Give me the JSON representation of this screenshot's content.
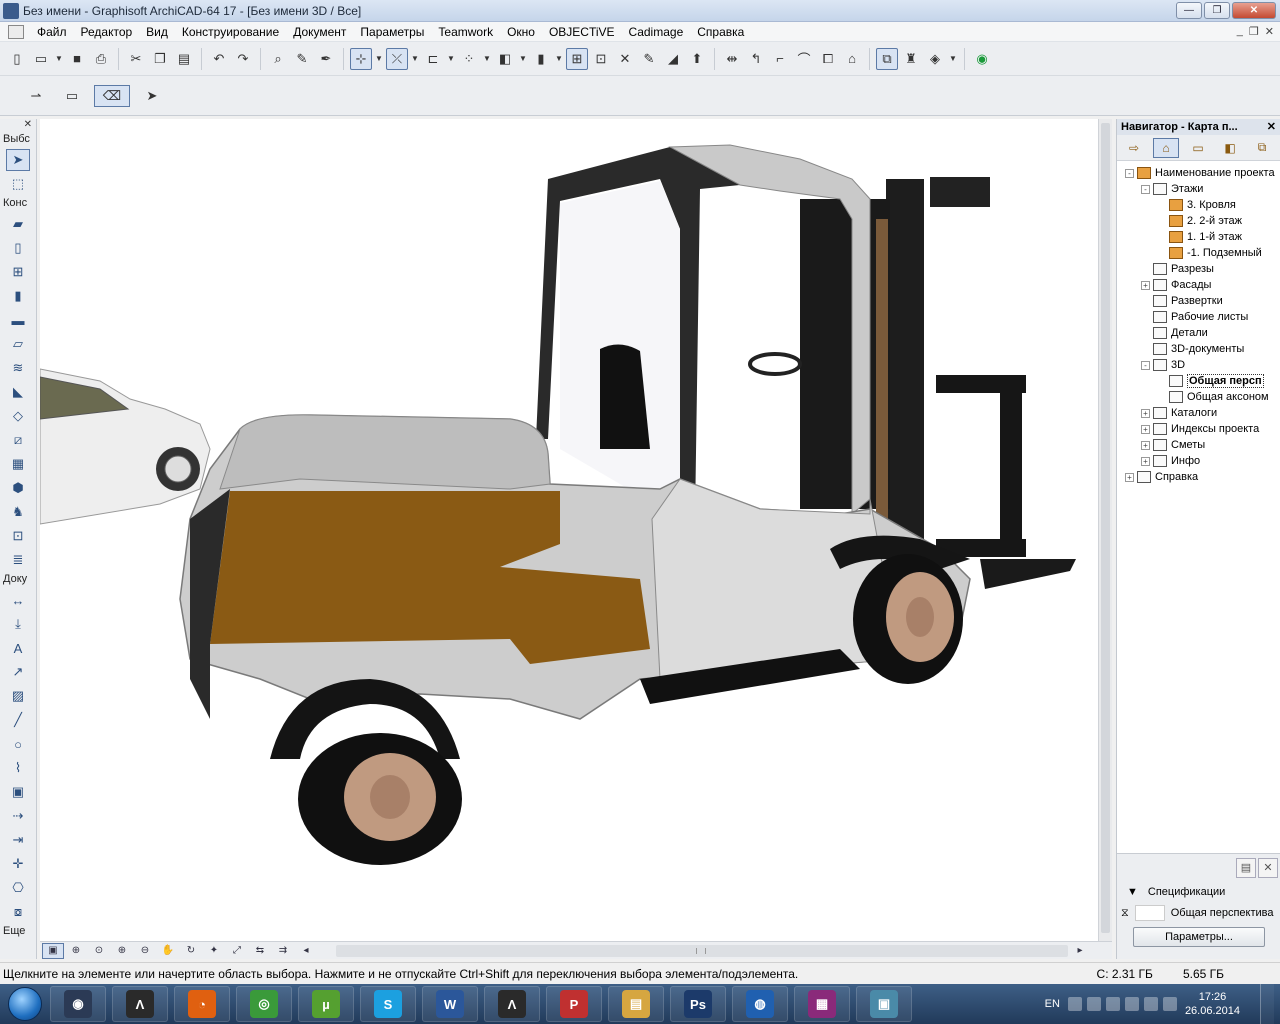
{
  "window": {
    "title": "Без имени - Graphisoft ArchiCAD-64 17 - [Без имени 3D / Все]",
    "buttons": {
      "minimize": "—",
      "restore": "❐",
      "close": "✕"
    }
  },
  "menu": {
    "items": [
      "Файл",
      "Редактор",
      "Вид",
      "Конструирование",
      "Документ",
      "Параметры",
      "Teamwork",
      "Окно",
      "OBJECTiVE",
      "Cadimage",
      "Справка"
    ],
    "right_controls": [
      "_",
      "❐",
      "✕"
    ]
  },
  "toolbox": {
    "close": "✕",
    "sections": [
      {
        "label": "Выбс"
      },
      {
        "label": "Конс"
      },
      {
        "label": "Доку"
      },
      {
        "label": "Еще"
      }
    ]
  },
  "navigator": {
    "title": "Навигатор - Карта п...",
    "close": "✕",
    "tree": [
      {
        "label": "Наименование проекта",
        "level": 0,
        "exp": "-",
        "icon": "house"
      },
      {
        "label": "Этажи",
        "level": 1,
        "exp": "-",
        "icon": "stories"
      },
      {
        "label": "3. Кровля",
        "level": 2,
        "exp": "",
        "icon": "story"
      },
      {
        "label": "2. 2-й этаж",
        "level": 2,
        "exp": "",
        "icon": "story"
      },
      {
        "label": "1. 1-й этаж",
        "level": 2,
        "exp": "",
        "icon": "story"
      },
      {
        "label": "-1. Подземный",
        "level": 2,
        "exp": "",
        "icon": "story"
      },
      {
        "label": "Разрезы",
        "level": 1,
        "exp": "",
        "icon": "section"
      },
      {
        "label": "Фасады",
        "level": 1,
        "exp": "+",
        "icon": "elevation"
      },
      {
        "label": "Развертки",
        "level": 1,
        "exp": "",
        "icon": "interior"
      },
      {
        "label": "Рабочие листы",
        "level": 1,
        "exp": "",
        "icon": "worksheet"
      },
      {
        "label": "Детали",
        "level": 1,
        "exp": "",
        "icon": "detail"
      },
      {
        "label": "3D-документы",
        "level": 1,
        "exp": "",
        "icon": "3d-doc"
      },
      {
        "label": "3D",
        "level": 1,
        "exp": "-",
        "icon": "3d"
      },
      {
        "label": "Общая персп",
        "level": 2,
        "exp": "",
        "icon": "camera",
        "selected": true
      },
      {
        "label": "Общая аксоном",
        "level": 2,
        "exp": "",
        "icon": "axon"
      },
      {
        "label": "Каталоги",
        "level": 1,
        "exp": "+",
        "icon": "schedules"
      },
      {
        "label": "Индексы проекта",
        "level": 1,
        "exp": "+",
        "icon": "indexes"
      },
      {
        "label": "Сметы",
        "level": 1,
        "exp": "+",
        "icon": "lists"
      },
      {
        "label": "Инфо",
        "level": 1,
        "exp": "+",
        "icon": "info"
      },
      {
        "label": "Справка",
        "level": 0,
        "exp": "+",
        "icon": "help"
      }
    ],
    "specs_label": "Спецификации",
    "perspective_label": "Общая перспектива",
    "params_button": "Параметры..."
  },
  "status": {
    "hint": "Щелкните на элементе или начертите область выбора. Нажмите и не отпускайте Ctrl+Shift для переключения выбора элемента/подэлемента.",
    "mem1": "C: 2.31 ГБ",
    "mem2": "5.65 ГБ"
  },
  "taskbar": {
    "lang": "EN",
    "time": "17:26",
    "date": "26.06.2014",
    "apps": [
      {
        "name": "cinema4d",
        "color": "#2b3a55",
        "glyph": "◉"
      },
      {
        "name": "archicad",
        "color": "#2a2a2a",
        "glyph": "Λ"
      },
      {
        "name": "chart-app",
        "color": "#e06010",
        "glyph": "◔"
      },
      {
        "name": "chrome",
        "color": "#3a9a3a",
        "glyph": "◎"
      },
      {
        "name": "utorrent",
        "color": "#55a030",
        "glyph": "µ"
      },
      {
        "name": "skype",
        "color": "#1ca0e0",
        "glyph": "S"
      },
      {
        "name": "word",
        "color": "#2b579a",
        "glyph": "W"
      },
      {
        "name": "archicad-2",
        "color": "#2a2a2a",
        "glyph": "Λ"
      },
      {
        "name": "pdf-tool",
        "color": "#c03030",
        "glyph": "P"
      },
      {
        "name": "explorer",
        "color": "#d6a640",
        "glyph": "▤"
      },
      {
        "name": "photoshop",
        "color": "#1c3a6a",
        "glyph": "Ps"
      },
      {
        "name": "google-earth",
        "color": "#2060b0",
        "glyph": "◍"
      },
      {
        "name": "winrar",
        "color": "#8a2a7a",
        "glyph": "▦"
      },
      {
        "name": "image-viewer",
        "color": "#4a8aa8",
        "glyph": "▣"
      }
    ]
  },
  "colors": {
    "body_orange": "#8a5a14",
    "body_grey": "#c8c8c8",
    "wheel_hub": "#c09a80",
    "selection": "#d8e3f3"
  }
}
